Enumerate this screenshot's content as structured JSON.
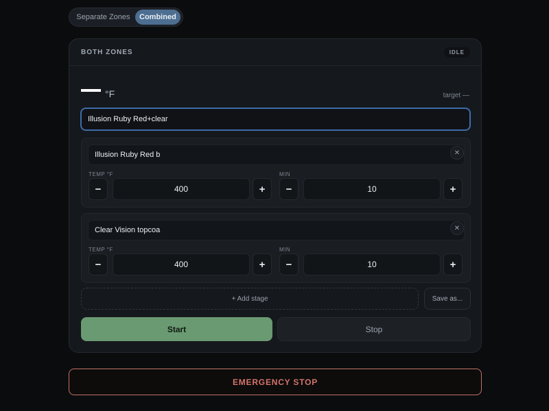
{
  "mode_toggle": {
    "options": [
      "Separate Zones",
      "Combined"
    ],
    "selected": "Combined"
  },
  "panel": {
    "title": "BOTH ZONES",
    "status": "IDLE",
    "temperature": {
      "value": "",
      "unit": "°F"
    },
    "target_label": "target —",
    "profile_name": "Illusion Ruby Red+clear",
    "stages": [
      {
        "name": "Illusion Ruby Red b",
        "temp_label": "TEMP °F",
        "temp": "400",
        "min_label": "MIN",
        "minutes": "10"
      },
      {
        "name": "Clear Vision topcoa",
        "temp_label": "TEMP °F",
        "temp": "400",
        "min_label": "MIN",
        "minutes": "10"
      }
    ],
    "add_stage_label": "+ Add stage",
    "save_as_label": "Save as...",
    "start_label": "Start",
    "stop_label": "Stop"
  },
  "emergency_stop_label": "EMERGENCY STOP",
  "icons": {
    "remove": "close-icon",
    "decrement": "minus-icon",
    "increment": "plus-icon"
  },
  "colors": {
    "accent": "#4d6e90",
    "focus_border": "#3f6daa",
    "start": "#6a9a72",
    "emergency": "#d2756b",
    "background": "#0b0c0e",
    "card": "#15181d"
  }
}
